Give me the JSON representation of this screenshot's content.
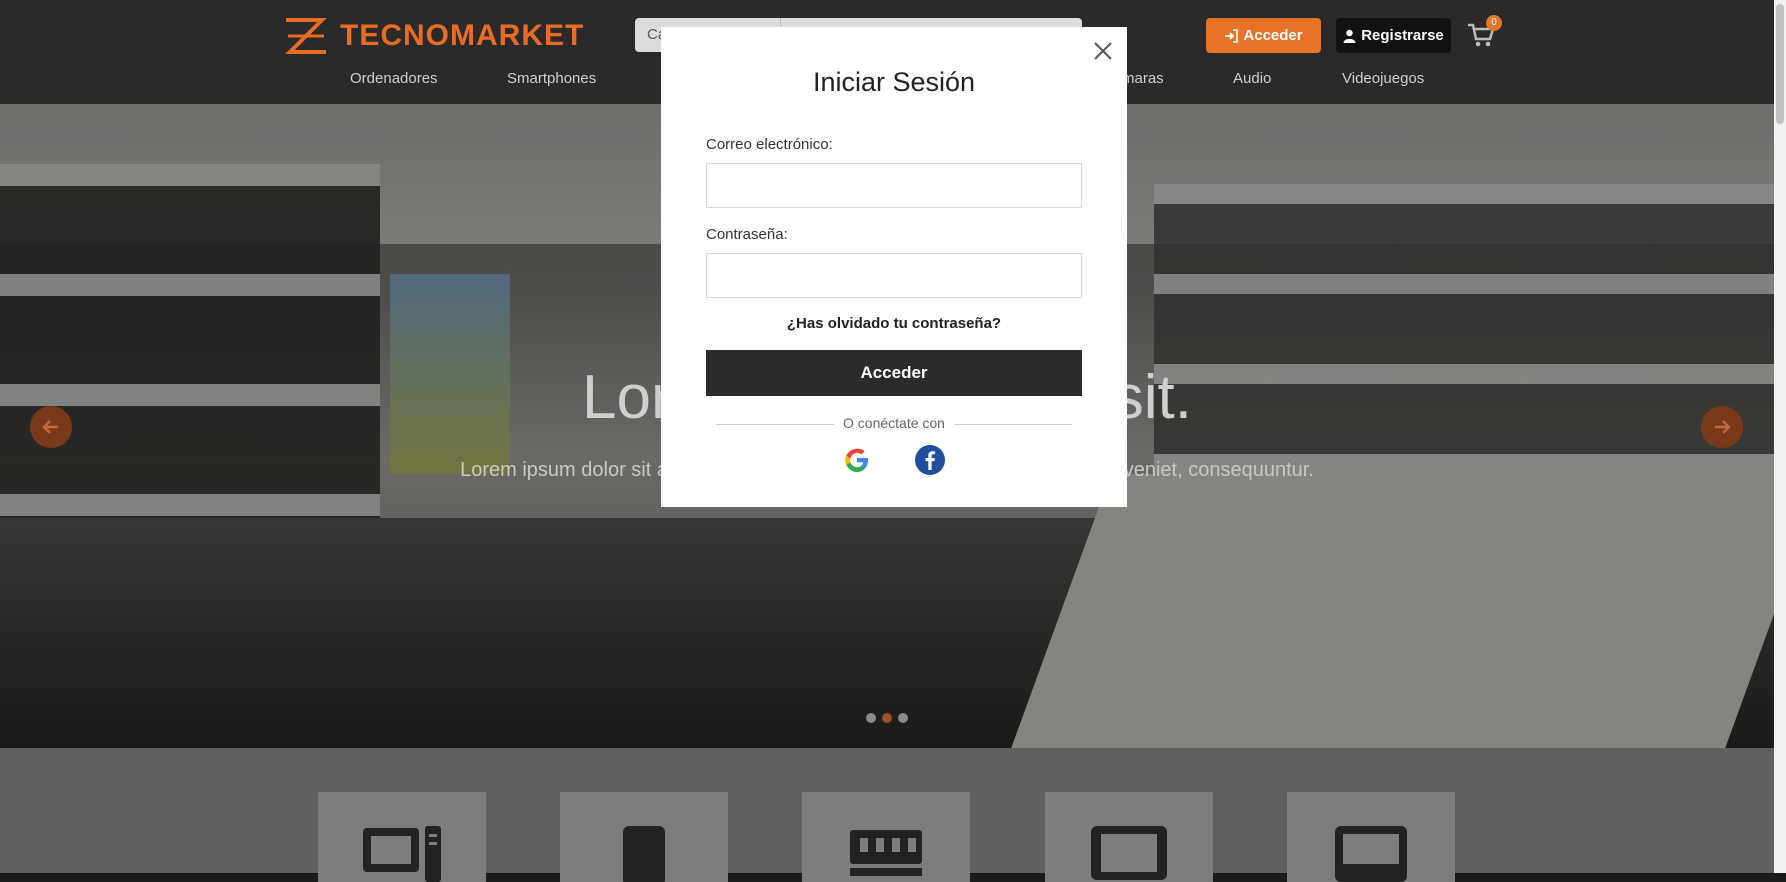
{
  "header": {
    "logo_text": "TECNOMARKET",
    "search_category_placeholder": "Ca",
    "acceder_label": "Acceder",
    "registrarse_label": "Registrarse",
    "cart_count": "0"
  },
  "nav": {
    "items": [
      "Ordenadores",
      "Smartphones",
      "maras",
      "Audio",
      "Videojuegos"
    ]
  },
  "hero": {
    "title": "Lorem ipsum dolor sit.",
    "subtitle": "Lorem ipsum dolor sit amet consectetur adipisicing elit. Quam, inventore! Eveniet, consequuntur."
  },
  "modal": {
    "title": "Iniciar Sesión",
    "email_label": "Correo electrónico:",
    "password_label": "Contraseña:",
    "forgot_link": "¿Has olvidado tu contraseña?",
    "submit_label": "Acceder",
    "separator_text": "O conéctate con"
  },
  "colors": {
    "accent": "#e67329",
    "header_bg": "#2a2a2a",
    "submit_bg": "#2b2b2b"
  }
}
